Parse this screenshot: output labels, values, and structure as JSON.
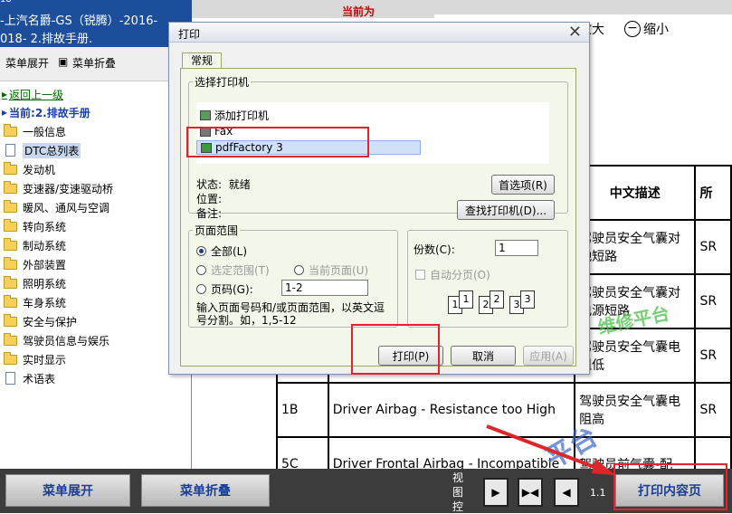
{
  "sidebar": {
    "top_fragment": "18",
    "title_line1": "-上汽名爵-GS（锐腾）-2016-",
    "title_line2": "018- 2.排故手册.",
    "menu_expand": "菜单展开",
    "menu_collapse_glyph": "▣",
    "menu_collapse": "菜单折叠",
    "back_link": "返回上一级",
    "current": "当前:2.排故手册",
    "items": [
      {
        "label": "一般信息",
        "icon": "folder"
      },
      {
        "label": "DTC总列表",
        "icon": "doc"
      },
      {
        "label": "发动机",
        "icon": "folder"
      },
      {
        "label": "变速器/变速驱动桥",
        "icon": "folder"
      },
      {
        "label": "暖风、通风与空调",
        "icon": "folder"
      },
      {
        "label": "转向系统",
        "icon": "folder"
      },
      {
        "label": "制动系统",
        "icon": "folder"
      },
      {
        "label": "外部装置",
        "icon": "folder"
      },
      {
        "label": "照明系统",
        "icon": "folder"
      },
      {
        "label": "车身系统",
        "icon": "folder"
      },
      {
        "label": "安全与保护",
        "icon": "folder"
      },
      {
        "label": "驾驶员信息与娱乐",
        "icon": "folder"
      },
      {
        "label": "实时显示",
        "icon": "folder"
      },
      {
        "label": "术语表",
        "icon": "doc"
      }
    ]
  },
  "main": {
    "current_label": "当前为",
    "zoom_in": "放大",
    "zoom_out": "缩小",
    "table": {
      "header_desc": "中文描述",
      "header_partial": "所",
      "rows": [
        {
          "code": "",
          "en": "",
          "cn": "驾驶员安全气囊对地短路",
          "tail": "SR"
        },
        {
          "code": "",
          "en": "",
          "cn": "驾驶员安全气囊对电源短路",
          "tail": "SR"
        },
        {
          "code": "",
          "en": "",
          "cn": "驾驶员安全气囊电阻低",
          "tail": "SR"
        },
        {
          "code": "1B",
          "en": "Driver Airbag - Resistance too High",
          "cn": "驾驶员安全气囊电阻高",
          "tail": "SR"
        },
        {
          "code": "5C",
          "en": "Driver Frontal Airbag - Incompatible",
          "cn": "驾驶员前气囊-配",
          "tail": ""
        }
      ]
    },
    "watermark1": "维修平台",
    "watermark2": "平台"
  },
  "dialog": {
    "title": "打印",
    "tab": "常规",
    "select_printer_legend": "选择打印机",
    "printers": [
      "添加打印机",
      "Fax",
      "pdfFactory 3"
    ],
    "status_label": "状态:",
    "status_value": "就绪",
    "location_label": "位置:",
    "comment_label": "备注:",
    "preferences_btn": "首选项(R)",
    "find_printer_btn": "查找打印机(D)...",
    "page_range_legend": "页面范围",
    "all": "全部(L)",
    "selection": "选定范围(T)",
    "current_page": "当前页面(U)",
    "pages": "页码(G):",
    "pages_value": "1-2",
    "hint": "输入页面号码和/或页面范围，以英文逗号分割。如，1,5-12",
    "copies_label": "份数(C):",
    "copies_value": "1",
    "collate": "自动分页(O)",
    "print_btn": "打印(P)",
    "cancel_btn": "取消",
    "apply_btn": "应用(A)"
  },
  "bottom": {
    "expand_btn": "菜单展开",
    "collapse_btn": "菜单折叠",
    "view_label": "视图控",
    "page_num": "1.1",
    "print_content_btn": "打印内容页"
  },
  "colors": {
    "titlebar": "#1d4e9b",
    "highlight_box": "#e0252a",
    "button_text": "#1b3f96"
  }
}
